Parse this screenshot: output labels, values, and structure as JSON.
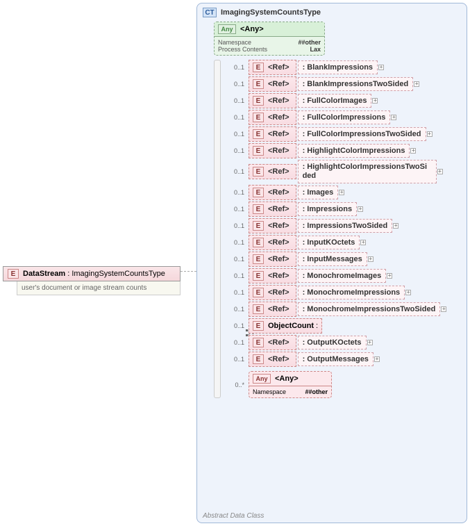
{
  "root": {
    "name": "DataStream",
    "type": "ImagingSystemCountsType",
    "description": "user's document or image stream counts"
  },
  "ct": {
    "title": "ImagingSystemCountsType",
    "footer": "Abstract Data Class"
  },
  "any_top": {
    "label": "<Any>",
    "namespace_label": "Namespace",
    "namespace_val": "##other",
    "process_label": "Process Contents",
    "process_val": "Lax"
  },
  "children": [
    {
      "card": "0..1",
      "ref": "<Ref>",
      "name": "BlankImpressions",
      "expand": true,
      "optional": true
    },
    {
      "card": "0..1",
      "ref": "<Ref>",
      "name": "BlankImpressionsTwoSided",
      "expand": true,
      "optional": true
    },
    {
      "card": "0..1",
      "ref": "<Ref>",
      "name": "FullColorImages",
      "expand": true,
      "optional": true
    },
    {
      "card": "0..1",
      "ref": "<Ref>",
      "name": "FullColorImpressions",
      "expand": true,
      "optional": true
    },
    {
      "card": "0..1",
      "ref": "<Ref>",
      "name": "FullColorImpressionsTwoSided",
      "expand": true,
      "optional": true
    },
    {
      "card": "0..1",
      "ref": "<Ref>",
      "name": "HighlightColorImpressions",
      "expand": true,
      "optional": true
    },
    {
      "card": "0..1",
      "ref": "<Ref>",
      "name": "HighlightColorImpressionsTwoSided",
      "expand": true,
      "optional": true,
      "twoline": true
    },
    {
      "card": "0..1",
      "ref": "<Ref>",
      "name": "Images",
      "expand": true,
      "optional": true
    },
    {
      "card": "0..1",
      "ref": "<Ref>",
      "name": "Impressions",
      "expand": true,
      "optional": true
    },
    {
      "card": "0..1",
      "ref": "<Ref>",
      "name": "ImpressionsTwoSided",
      "expand": true,
      "optional": true
    },
    {
      "card": "0..1",
      "ref": "<Ref>",
      "name": "InputKOctets",
      "expand": true,
      "optional": true
    },
    {
      "card": "0..1",
      "ref": "<Ref>",
      "name": "InputMessages",
      "expand": true,
      "optional": true
    },
    {
      "card": "0..1",
      "ref": "<Ref>",
      "name": "MonochromeImages",
      "expand": true,
      "optional": true
    },
    {
      "card": "0..1",
      "ref": "<Ref>",
      "name": "MonochromeImpressions",
      "expand": true,
      "optional": true
    },
    {
      "card": "0..1",
      "ref": "<Ref>",
      "name": "MonochromeImpressionsTwoSided",
      "expand": true,
      "optional": true
    },
    {
      "card": "0..1",
      "direct": "ObjectCount",
      "value": "<None>",
      "optional": true
    },
    {
      "card": "0..1",
      "ref": "<Ref>",
      "name": "OutputKOctets",
      "expand": true,
      "optional": true
    },
    {
      "card": "0..1",
      "ref": "<Ref>",
      "name": "OutputMessages",
      "expand": true,
      "optional": true
    }
  ],
  "any_bottom": {
    "card": "0..*",
    "label": "<Any>",
    "namespace_label": "Namespace",
    "namespace_val": "##other"
  },
  "badges": {
    "E": "E",
    "CT": "CT",
    "Any": "Any"
  }
}
